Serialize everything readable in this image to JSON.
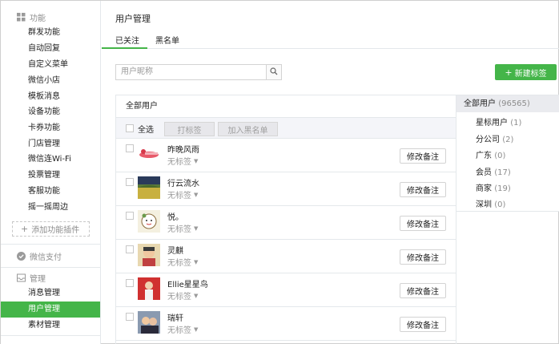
{
  "sidebar": {
    "sections": [
      {
        "title": "功能",
        "icon": "grid-icon"
      },
      {
        "title": "微信支付",
        "icon": "wechat-pay-icon"
      },
      {
        "title": "管理",
        "icon": "inbox-icon"
      }
    ],
    "function_items": [
      "群发功能",
      "自动回复",
      "自定义菜单",
      "微信小店",
      "模板消息",
      "设备功能",
      "卡券功能",
      "门店管理",
      "微信连Wi-Fi",
      "投票管理",
      "客服功能",
      "摇一摇周边"
    ],
    "add_plugin": "添加功能插件",
    "manage_items": [
      "消息管理",
      "用户管理",
      "素材管理"
    ],
    "active_item": "用户管理"
  },
  "main": {
    "title": "用户管理",
    "tabs": [
      "已关注",
      "黑名单"
    ],
    "active_tab": "已关注",
    "search_placeholder": "用户昵称",
    "new_tag_label": "新建标签"
  },
  "list": {
    "header": "全部用户",
    "select_all": "全选",
    "tag_button": "打标签",
    "blacklist_button": "加入黑名单",
    "remark_label": "修改备注",
    "users": [
      {
        "name": "昨晚风雨",
        "tag": "无标签"
      },
      {
        "name": "行云流水",
        "tag": "无标签"
      },
      {
        "name": "悦。",
        "tag": "无标签"
      },
      {
        "name": "灵麒",
        "tag": "无标签"
      },
      {
        "name": "Ellie星星鸟",
        "tag": "无标签"
      },
      {
        "name": "瑞轩",
        "tag": "无标签"
      }
    ]
  },
  "groups": {
    "all": {
      "name": "全部用户",
      "count": "(96565)"
    },
    "items": [
      {
        "name": "星标用户",
        "count": "(1)"
      },
      {
        "name": "分公司",
        "count": "(2)"
      },
      {
        "name": "广东",
        "count": "(0)"
      },
      {
        "name": "会员",
        "count": "(17)"
      },
      {
        "name": "商家",
        "count": "(19)"
      },
      {
        "name": "深圳",
        "count": "(0)"
      }
    ]
  },
  "colors": {
    "accent": "#44b549",
    "toolbar_bg": "#f4f5f9",
    "border": "#e4e8eb"
  }
}
